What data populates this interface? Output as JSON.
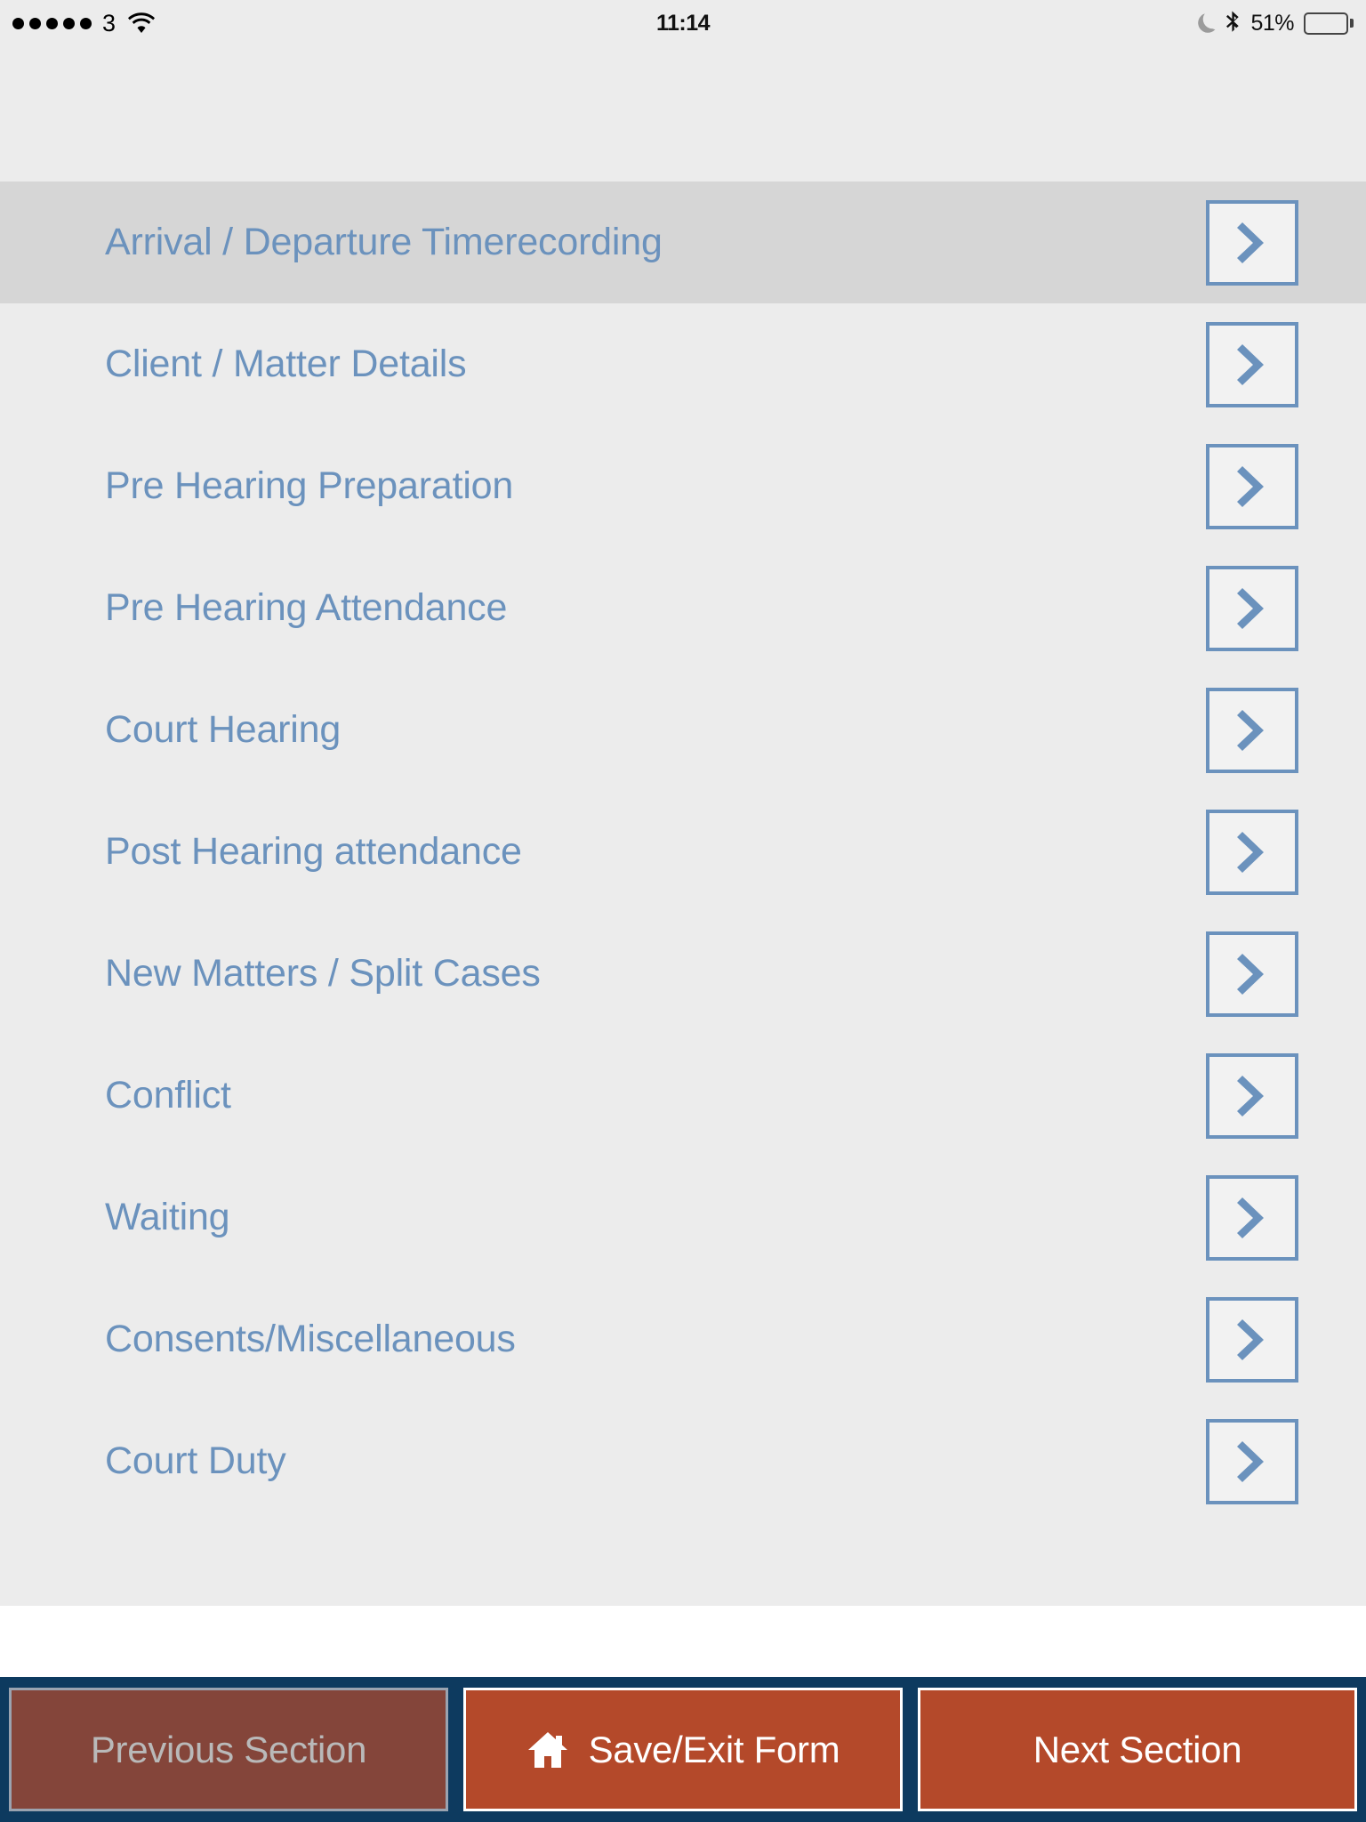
{
  "status_bar": {
    "signal_dots": 5,
    "carrier": "3",
    "wifi_icon": "wifi-icon",
    "time": "11:14",
    "dnd_icon": "moon-icon",
    "bluetooth_icon": "bluetooth-icon",
    "battery_percent_label": "51%",
    "battery_level": 51
  },
  "colors": {
    "page_background": "#ececec",
    "row_text": "#6b92bd",
    "selected_row_background": "#d6d6d6",
    "chevron_border": "#6b92bd",
    "toolbar_background": "#0d3a5f",
    "button_active": "#b4492a",
    "button_disabled": "#84453a",
    "button_disabled_text": "#b9b9b9"
  },
  "section_list": {
    "items": [
      {
        "label": "Arrival / Departure Timerecording",
        "selected": true,
        "chevron": "chevron-right-icon"
      },
      {
        "label": "Client / Matter Details",
        "selected": false,
        "chevron": "chevron-right-icon"
      },
      {
        "label": "Pre Hearing Preparation",
        "selected": false,
        "chevron": "chevron-right-icon"
      },
      {
        "label": "Pre Hearing Attendance",
        "selected": false,
        "chevron": "chevron-right-icon"
      },
      {
        "label": "Court Hearing",
        "selected": false,
        "chevron": "chevron-right-icon"
      },
      {
        "label": "Post Hearing attendance",
        "selected": false,
        "chevron": "chevron-right-icon"
      },
      {
        "label": "New Matters / Split Cases",
        "selected": false,
        "chevron": "chevron-right-icon"
      },
      {
        "label": "Conflict",
        "selected": false,
        "chevron": "chevron-right-icon"
      },
      {
        "label": "Waiting",
        "selected": false,
        "chevron": "chevron-right-icon"
      },
      {
        "label": "Consents/Miscellaneous",
        "selected": false,
        "chevron": "chevron-right-icon"
      },
      {
        "label": "Court Duty",
        "selected": false,
        "chevron": "chevron-right-icon"
      }
    ]
  },
  "toolbar": {
    "previous_label": "Previous Section",
    "previous_disabled": true,
    "save_exit_label": "Save/Exit Form",
    "save_exit_icon": "home-icon",
    "next_label": "Next Section",
    "next_disabled": false
  }
}
